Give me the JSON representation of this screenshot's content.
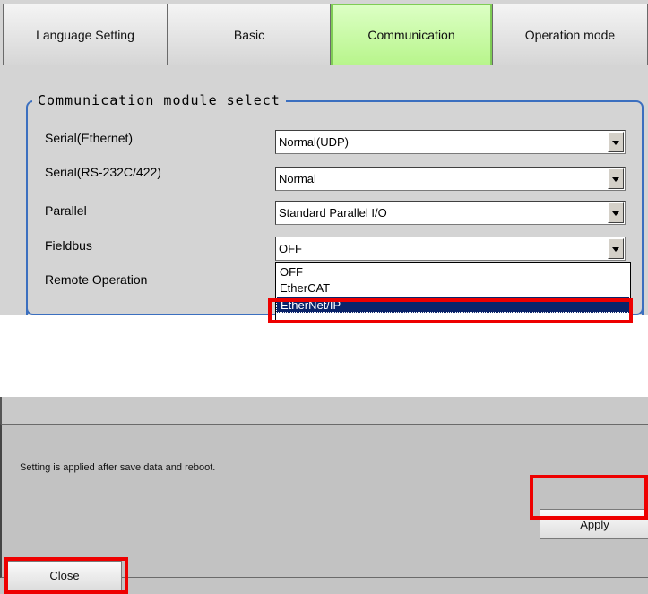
{
  "tabs": [
    {
      "label": "Language Setting",
      "active": false
    },
    {
      "label": "Basic",
      "active": false
    },
    {
      "label": "Communication",
      "active": true
    },
    {
      "label": "Operation mode",
      "active": false
    }
  ],
  "group": {
    "title": "Communication module select",
    "rows": [
      {
        "label": "Serial(Ethernet)",
        "value": "Normal(UDP)"
      },
      {
        "label": "Serial(RS-232C/422)",
        "value": "Normal"
      },
      {
        "label": "Parallel",
        "value": "Standard Parallel I/O"
      },
      {
        "label": "Fieldbus",
        "value": "OFF"
      },
      {
        "label": "Remote Operation",
        "value": ""
      }
    ]
  },
  "fieldbus_dropdown": {
    "options": [
      "OFF",
      "EtherCAT",
      "EtherNet/IP"
    ],
    "selected": "EtherNet/IP"
  },
  "footer": {
    "note": "Setting is applied after save data and reboot.",
    "apply_label": "Apply",
    "close_label": "Close"
  },
  "colors": {
    "active_tab": "#b8f58c",
    "group_border": "#3b6fbf",
    "highlight": "#ee0000",
    "selection": "#0a246a"
  },
  "icons": {
    "combo_arrow": "chevron-down-icon"
  }
}
